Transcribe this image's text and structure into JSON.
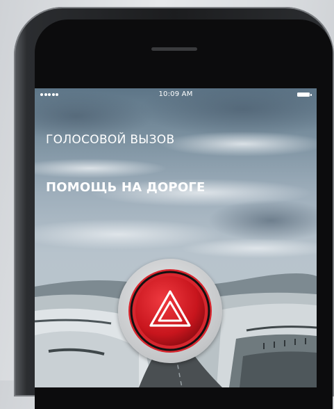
{
  "status_bar": {
    "signal_icon": "signal-dots-icon",
    "time": "10:09 AM",
    "battery_icon": "battery-icon"
  },
  "voice_call_label": "ГОЛОСОВОЙ ВЫЗОВ",
  "roadside_assistance_label": "ПОМОЩЬ НА ДОРОГЕ",
  "emergency_button": {
    "icon": "hazard-warning-triangle-icon",
    "colors": {
      "ring": "#d7262e",
      "inner": "#c8151d",
      "outline": "#111111"
    }
  }
}
